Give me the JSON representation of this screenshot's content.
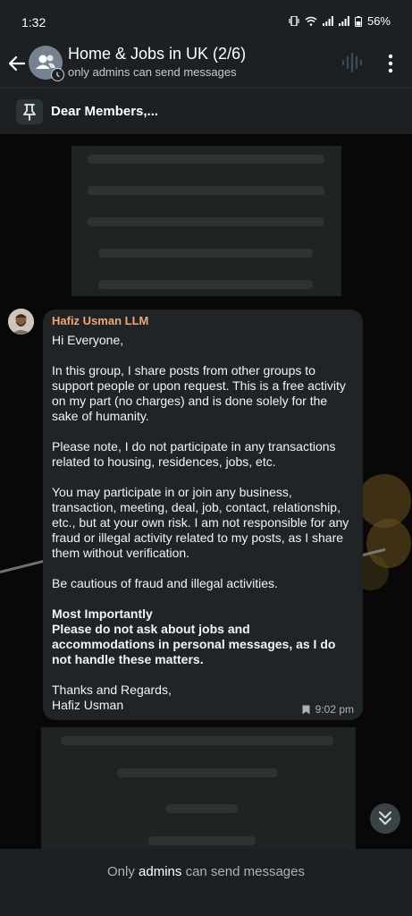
{
  "status": {
    "time": "1:32",
    "battery": "56%"
  },
  "header": {
    "title": "Home & Jobs in UK (2/6)",
    "subtitle": "only admins can send messages"
  },
  "pinned": {
    "text": "Dear Members,..."
  },
  "message": {
    "sender": "Hafiz Usman LLM",
    "greeting": "Hi Everyone,",
    "p1": "In this group, I share posts from other groups to support people or upon request. This is a free activity on my part (no charges) and is done solely for the sake of humanity.",
    "p2": "Please note, I do not participate in any transactions related to housing, residences, jobs, etc.",
    "p3": "You may participate in or join any business, transaction, meeting, deal, job, contact, relationship, etc., but at your own risk. I am not responsible for any fraud or illegal activity related to my posts, as I share them without verification.",
    "p4": "Be cautious of fraud and illegal activities.",
    "bold_heading": "Most Importantly",
    "bold_text": "Please do not ask about jobs and accommodations in personal messages, as I do not handle these matters.",
    "closing": "Thanks and Regards,",
    "signature": "Hafiz Usman",
    "time": "9:02 pm"
  },
  "footer": {
    "prefix": "Only",
    "highlight": "admins",
    "suffix": "can send messages"
  },
  "colors": {
    "sender_name": "#f3a574",
    "header_bg": "#1c2022",
    "bubble_bg": "#1f2426"
  },
  "icons": [
    "back-arrow-icon",
    "group-icon",
    "clock-icon",
    "voice-chat-icon",
    "more-vertical-icon",
    "pin-icon",
    "bookmark-icon",
    "double-chevron-down-icon"
  ]
}
